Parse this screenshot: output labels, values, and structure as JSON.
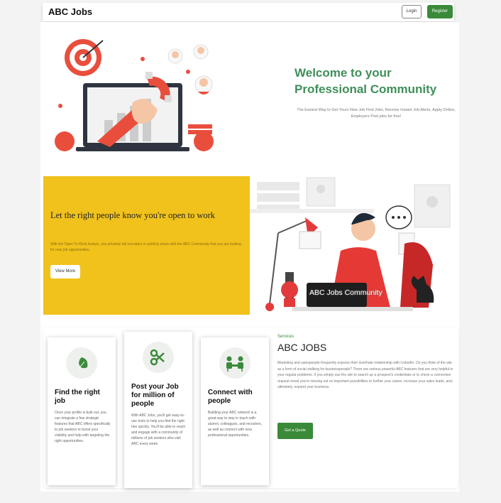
{
  "navbar": {
    "brand": "ABC Jobs",
    "login_label": "Login",
    "register_label": "Register"
  },
  "hero": {
    "title": "Welcome to your Professional Community",
    "subtitle": "The Easiest Way to Get Yours New Job Find Jobs, Receive Instant Job Alerts, Apply Online, Employers Post jobs for free!"
  },
  "open_to_work": {
    "title": "Let the right people know you're open to work",
    "text": "With the Open To Work feature, you privately tell recruiters or publicly share with the ABC Community that you are looking for new job opportunities.",
    "button_label": "View More",
    "illustration_caption": "ABC Jobs Community"
  },
  "cards": [
    {
      "title": "Find the right job",
      "text": "Once your profile is built out, you can integrate a few strategic features that ABC offers specifically to job seekers to boost your visibility and help with targeting the right opportunities.",
      "icon": "leaf-icon"
    },
    {
      "title": "Post your Job for million of people",
      "text": "With ABC Jobs, you'll get easy-to-use tools to help you find the right hire quickly. You'll be able to reach and engage with a community of millions of job seekers who visit ABC every week.",
      "icon": "scissors-icon"
    },
    {
      "title": "Connect with people",
      "text": "Building your ABC network is a great way to stay in touch with alumni, colleagues, and recruiters, as well as connect with new, professional opportunities.",
      "icon": "people-icon"
    }
  ],
  "services": {
    "label": "Services",
    "title": "ABC JOBS",
    "text": "Marketing and salespeople frequently express their love/hate relationship with LinkedIn. Do you think of the site as a form of social stalking for businesspeople? There are various powerful ABC features that are very helpful in your regular problems. If you simply use the site to search up a prospect's credentials or to check a connection request email you're missing out on important possibilities to further your career, increase your sales leads, and, ultimately, expand your business.",
    "button_label": "Get a Quote"
  },
  "colors": {
    "brand_green": "#3a8a3a",
    "title_green": "#3f8f5a",
    "banner_yellow": "#f1c21b"
  }
}
